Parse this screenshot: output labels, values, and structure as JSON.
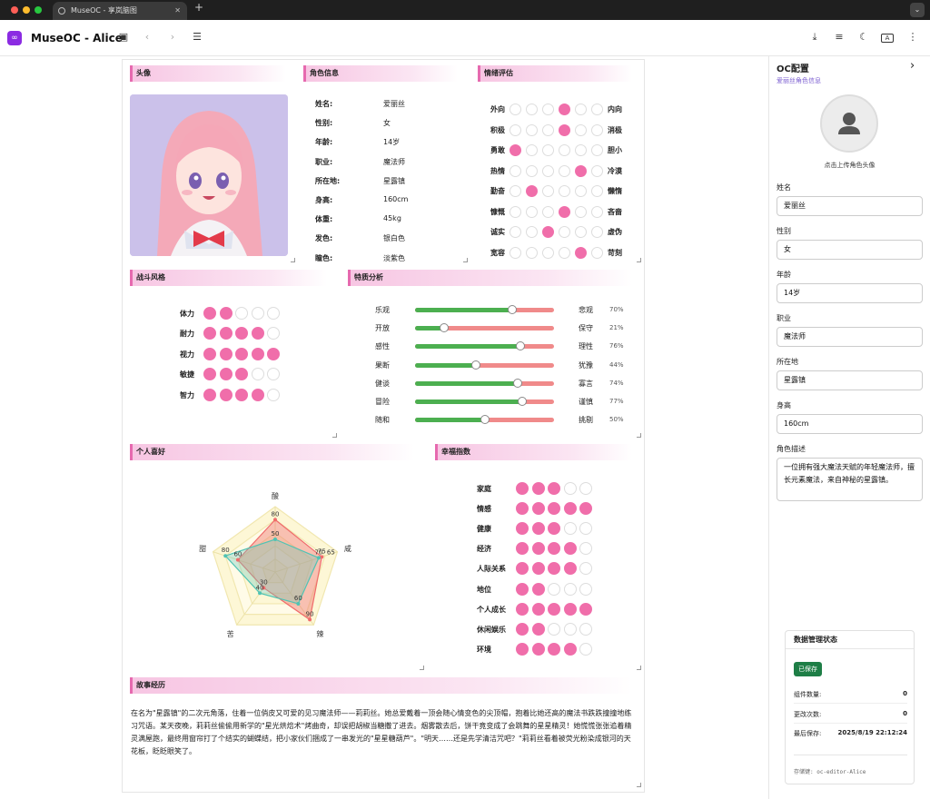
{
  "browser": {
    "tab_title": "MuseOC - 享岚脑图",
    "close": "✕",
    "new_tab": "+",
    "menu": "⌄"
  },
  "app": {
    "title": "MuseOC - Alice",
    "logo": "∞"
  },
  "toolbar_icons": [
    "save-icon",
    "back-icon",
    "forward-icon",
    "list-icon",
    "download-icon",
    "menu-icon",
    "moon-icon",
    "translate-icon",
    "more-icon"
  ],
  "sections": {
    "avatar": "头像",
    "info": "角色信息",
    "emotion": "情绪评估",
    "combat": "战斗风格",
    "traits": "特质分析",
    "hobbies": "个人喜好",
    "happiness": "幸福指数",
    "story": "故事经历"
  },
  "info": [
    [
      "姓名:",
      "爱丽丝"
    ],
    [
      "性别:",
      "女"
    ],
    [
      "年龄:",
      "14岁"
    ],
    [
      "职业:",
      "魔法师"
    ],
    [
      "所在地:",
      "星露镇"
    ],
    [
      "身高:",
      "160cm"
    ],
    [
      "体重:",
      "45kg"
    ],
    [
      "发色:",
      "银白色"
    ],
    [
      "瞳色:",
      "淡紫色"
    ]
  ],
  "emotion": [
    {
      "left": "外向",
      "right": "内向",
      "value": 4
    },
    {
      "left": "积极",
      "right": "消极",
      "value": 4
    },
    {
      "left": "勇敢",
      "right": "胆小",
      "value": 1
    },
    {
      "left": "热情",
      "right": "冷漠",
      "value": 5
    },
    {
      "left": "勤奋",
      "right": "懒惰",
      "value": 2
    },
    {
      "left": "慷慨",
      "right": "吝啬",
      "value": 4
    },
    {
      "left": "诚实",
      "right": "虚伪",
      "value": 3
    },
    {
      "left": "宽容",
      "right": "苛刻",
      "value": 5
    }
  ],
  "combat": [
    {
      "label": "体力",
      "value": 2
    },
    {
      "label": "耐力",
      "value": 4
    },
    {
      "label": "视力",
      "value": 5
    },
    {
      "label": "敏捷",
      "value": 3
    },
    {
      "label": "智力",
      "value": 4
    }
  ],
  "traits": [
    {
      "left": "乐观",
      "right": "悲观",
      "value": 70
    },
    {
      "left": "开放",
      "right": "保守",
      "value": 21
    },
    {
      "left": "感性",
      "right": "理性",
      "value": 76
    },
    {
      "left": "果断",
      "right": "犹豫",
      "value": 44
    },
    {
      "left": "健谈",
      "right": "寡言",
      "value": 74
    },
    {
      "left": "冒险",
      "right": "谨慎",
      "value": 77
    },
    {
      "left": "随和",
      "right": "挑剔",
      "value": 50
    }
  ],
  "hobbies_chart": {
    "axes": [
      "酸",
      "咸",
      "辣",
      "苦",
      "甜"
    ],
    "series_a": [
      80,
      75,
      90,
      30,
      60
    ],
    "series_b": [
      50,
      70,
      60,
      40,
      80
    ],
    "labels_a": [
      "80",
      "75",
      "90",
      "30",
      "60"
    ],
    "labels_b": [
      "50",
      "70",
      "60",
      "40",
      "80"
    ],
    "label_b_extra": "65"
  },
  "happiness": [
    {
      "label": "家庭",
      "value": 3
    },
    {
      "label": "情感",
      "value": 5
    },
    {
      "label": "健康",
      "value": 3
    },
    {
      "label": "经济",
      "value": 4
    },
    {
      "label": "人际关系",
      "value": 4
    },
    {
      "label": "地位",
      "value": 2
    },
    {
      "label": "个人成长",
      "value": 5
    },
    {
      "label": "休闲娱乐",
      "value": 2
    },
    {
      "label": "环境",
      "value": 4
    }
  ],
  "story": "在名为\"星露镇\"的二次元角落，住着一位俏皮又可爱的见习魔法师——莉莉丝。她总爱戴着一顶会随心情变色的尖顶帽，抱着比她还高的魔法书跌跌撞撞地练习咒语。某天夜晚，莉莉丝偷偷用新学的\"星光烘焙术\"烤曲奇，却误把胡椒当糖撒了进去。烟雾散去后，饼干竟变成了会跳舞的星星精灵！她慌慌张张追着精灵满屋跑，最终用窗帘打了个结实的蝴蝶结，把小家伙们捆成了一串发光的\"星星糖葫芦\"。\"明天……还是先学清洁咒吧？\"莉莉丝看着被荧光粉染成银河的天花板，眨眨眼笑了。",
  "sidebar": {
    "title": "OC配置",
    "subtitle": "爱丽丝角色信息",
    "upload": "点击上传角色头像",
    "expand": "›",
    "fields": [
      {
        "label": "姓名",
        "value": "爱丽丝"
      },
      {
        "label": "性别",
        "value": "女"
      },
      {
        "label": "年龄",
        "value": "14岁"
      },
      {
        "label": "职业",
        "value": "魔法师"
      },
      {
        "label": "所在地",
        "value": "星露镇"
      },
      {
        "label": "身高",
        "value": "160cm"
      }
    ],
    "desc_label": "角色描述",
    "desc": "一位拥有强大魔法天赋的年轻魔法师，擅长元素魔法，来自神秘的星露镇。"
  },
  "status": {
    "title": "数据管理状态",
    "badge": "已保存",
    "count_label": "组件数量:",
    "count": "0",
    "changes_label": "更改次数:",
    "changes": "0",
    "saved_label": "最后保存:",
    "saved": "2025/8/19 22:12:24",
    "key": "存储键: oc-editor-Alice"
  },
  "colors": {
    "accent": "#f06eaa",
    "green": "#4caf50",
    "red": "#f08a8a",
    "badge": "#1e7e46"
  }
}
